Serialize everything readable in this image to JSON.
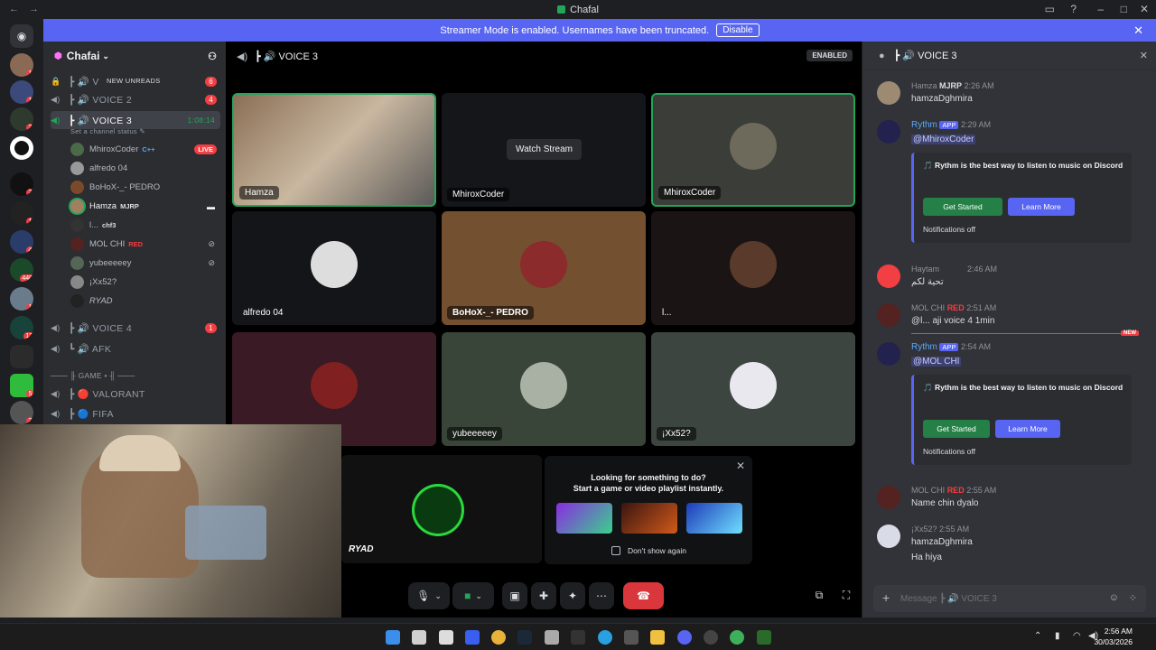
{
  "window": {
    "title": "Chafal",
    "nav_back": "←",
    "nav_forward": "→"
  },
  "banner": {
    "text": "Streamer Mode is enabled. Usernames have been truncated.",
    "button": "Disable"
  },
  "server": {
    "name": "Chafai"
  },
  "channels": [
    {
      "name": "┣ 🔊 V",
      "badge": "6",
      "new_unreads": "NEW UNREADS"
    },
    {
      "name": "┣ 🔊 VOICE 2",
      "badge": "4"
    },
    {
      "name": "┣ 🔊 VOICE 3",
      "time": "1:08:14",
      "status": "Set a channel status ✎"
    },
    {
      "name": "┣ 🔊 VOICE 4",
      "badge": "1"
    },
    {
      "name": "┗ 🔊 AFK"
    },
    {
      "name": "─── ╟ GAME • ╢ ───"
    },
    {
      "name": "┣ 🔴 VALORANT"
    },
    {
      "name": "┣ 🔵 FIFA"
    }
  ],
  "voice_users": [
    {
      "name": "MhiroxCoder",
      "tag": "C++",
      "live": "LIVE"
    },
    {
      "name": "alfredo 04"
    },
    {
      "name": "BoHoX-_- PEDRO"
    },
    {
      "name": "Hamza",
      "tag": "MJRP"
    },
    {
      "name": "l...",
      "tag": "chf3"
    },
    {
      "name": "MOL CHI",
      "tag": "RED"
    },
    {
      "name": "yubeeeeey"
    },
    {
      "name": "¡Xx52?"
    },
    {
      "name": "RYAD"
    }
  ],
  "stage": {
    "title": "┣ 🔊 VOICE 3",
    "enabled": "ENABLED",
    "tiles": [
      {
        "name": "Hamza"
      },
      {
        "name": "MhiroxCoder",
        "watch": "Watch Stream"
      },
      {
        "name": "MhiroxCoder"
      },
      {
        "name": "alfredo 04"
      },
      {
        "name": "BoHoX-_- PEDRO"
      },
      {
        "name": "l..."
      },
      {
        "name": ""
      },
      {
        "name": "yubeeeeey"
      },
      {
        "name": "¡Xx52?"
      }
    ],
    "ryad": "RYAD",
    "popup": {
      "line1": "Looking for something to do?",
      "line2": "Start a game or video playlist instantly.",
      "checkbox": "Don't show again"
    }
  },
  "chat": {
    "title": "┣ 🔊 VOICE 3",
    "messages": [
      {
        "author": "Hamza",
        "tag": "MJRP",
        "time": "2:26 AM",
        "text": "hamzaDghmira"
      },
      {
        "author": "Rythm",
        "app": "APP",
        "time": "2:29 AM",
        "text": "@MhiroxCoder",
        "embed": {
          "title": "🎵 Rythm is the best way to listen to music on Discord",
          "b1": "Get Started",
          "b2": "Learn More",
          "note": "Notifications off"
        }
      },
      {
        "author": "Haytam",
        "time": "2:46 AM",
        "text": "تحية لكم"
      },
      {
        "author": "MOL CHI",
        "tag": "RED",
        "time": "2:51 AM",
        "text": "@l... aji voice 4 1min"
      },
      {
        "author": "Rythm",
        "app": "APP",
        "time": "2:54 AM",
        "text": "@MOL CHI",
        "embed": {
          "title": "🎵 Rythm is the best way to listen to music on Discord",
          "b1": "Get Started",
          "b2": "Learn More",
          "note": "Notifications off"
        }
      },
      {
        "author": "MOL CHI",
        "tag": "RED",
        "time": "2:55 AM",
        "text": "Name chin dyalo"
      },
      {
        "author": "¡Xx52?",
        "time": "2:55 AM",
        "text": "hamzaDghmira",
        "text2": "Ha hiya"
      }
    ],
    "new_label": "NEW",
    "input_placeholder": "Message ┣ 🔊 VOICE 3"
  },
  "taskbar": {
    "time": "2:56 AM",
    "date": "30/03/2026"
  }
}
